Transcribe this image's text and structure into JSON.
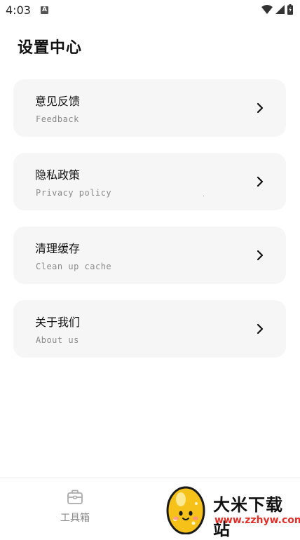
{
  "status_bar": {
    "time": "4:03",
    "notif_letter": "A"
  },
  "header": {
    "title": "设置中心"
  },
  "menu": [
    {
      "title": "意见反馈",
      "subtitle": "Feedback"
    },
    {
      "title": "隐私政策",
      "subtitle": "Privacy policy"
    },
    {
      "title": "清理缓存",
      "subtitle": "Clean up cache"
    },
    {
      "title": "关于我们",
      "subtitle": "About us"
    }
  ],
  "bottom_nav": {
    "tools_label": "工具箱"
  },
  "watermark": {
    "name": "大米下载站",
    "url": "www.zzhyw.com"
  },
  "colors": {
    "card_bg": "#f6f6f6",
    "watermark_url": "#e0302a",
    "tab_inactive": "#888888"
  }
}
